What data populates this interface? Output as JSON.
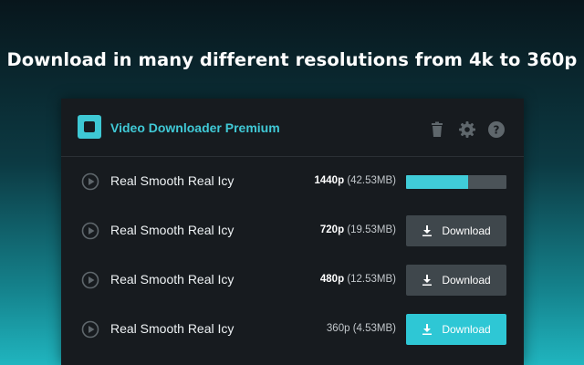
{
  "headline": "Download in many different resolutions from 4k to 360p",
  "app": {
    "title": "Video Downloader Premium",
    "accent_color": "#40c9d6",
    "header_icons": [
      "trash-icon",
      "gear-icon",
      "help-icon"
    ]
  },
  "downloads": [
    {
      "title": "Real Smooth Real Icy",
      "resolution": "1440p",
      "size": "(42.53MB)",
      "state": "downloading",
      "progress": 0.62
    },
    {
      "title": "Real Smooth Real Icy",
      "resolution": "720p",
      "size": "(19.53MB)",
      "state": "idle",
      "button_label": "Download"
    },
    {
      "title": "Real Smooth Real Icy",
      "resolution": "480p",
      "size": "(12.53MB)",
      "state": "idle",
      "button_label": "Download"
    },
    {
      "title": "Real Smooth Real Icy",
      "resolution": "360p",
      "size": "(4.53MB)",
      "state": "highlighted",
      "button_label": "Download"
    }
  ]
}
